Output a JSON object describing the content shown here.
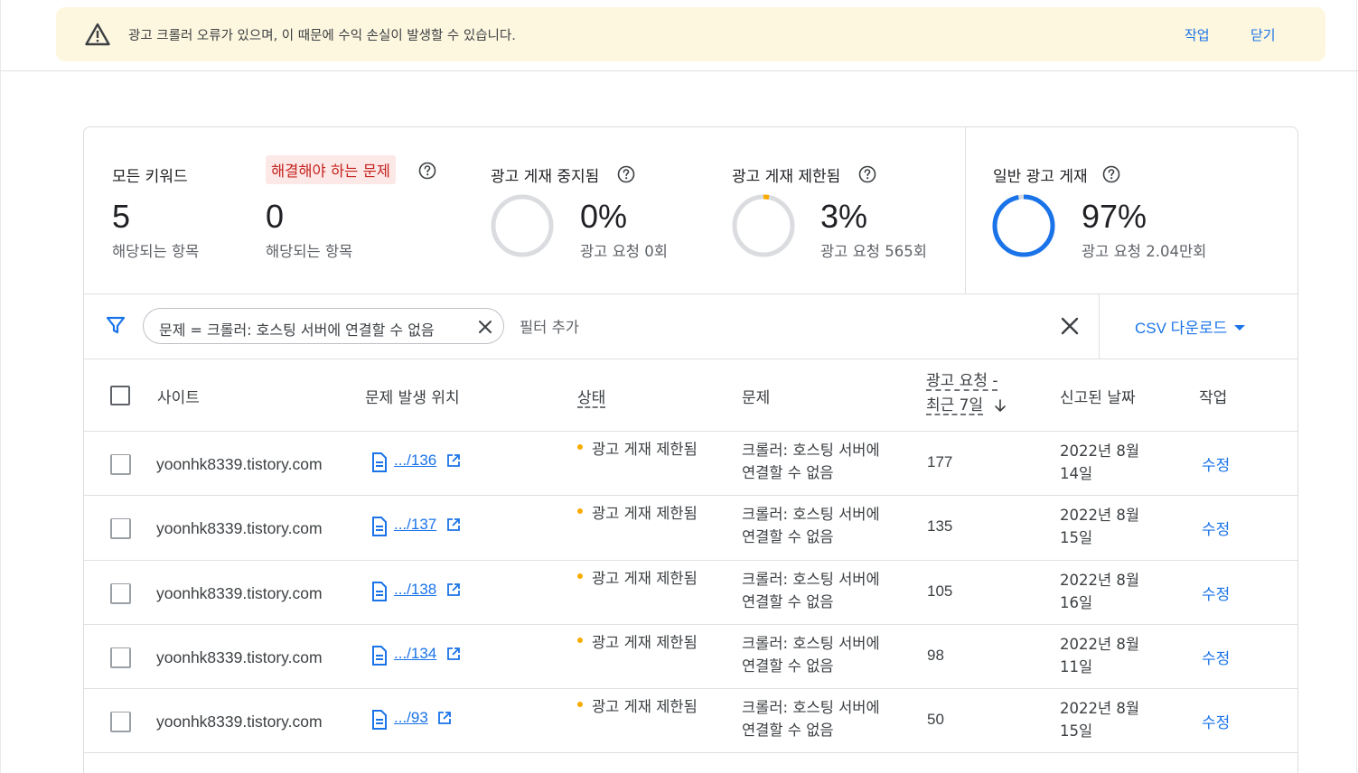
{
  "banner": {
    "message": "광고 크롤러 오류가 있으며, 이 때문에 수익 손실이 발생할 수 있습니다.",
    "action_label": "작업",
    "close_label": "닫기",
    "icon": "warning-icon"
  },
  "stats": {
    "all_keywords": {
      "label": "모든 키워드",
      "value": "5",
      "sub": "해당되는 항목"
    },
    "issues_to_fix": {
      "label": "해결해야 하는 문제",
      "value": "0",
      "sub": "해당되는 항목"
    },
    "ad_serving_stopped": {
      "label": "광고 게재 중지됨",
      "value": "0%",
      "sub": "광고 요청 0회",
      "fraction": 0.0
    },
    "ad_serving_limited": {
      "label": "광고 게재 제한됨",
      "value": "3%",
      "sub": "광고 요청 565회",
      "fraction": 0.03
    },
    "normal_ad_serving": {
      "label": "일반 광고 게재",
      "value": "97%",
      "sub": "광고 요청 2.04만회",
      "fraction": 0.97
    }
  },
  "colors": {
    "accent": "#1a73e8",
    "limited": "#f9ab00",
    "donut_track": "#dadce0",
    "danger_bg": "#fce8e6",
    "banner_bg": "#fef7e0"
  },
  "filter": {
    "chip_label": "문제 = 크롤러: 호스팅 서버에 연결할 수 없음",
    "add_filter_placeholder": "필터 추가",
    "csv_download_label": "CSV 다운로드"
  },
  "table": {
    "headers": {
      "site": "사이트",
      "location": "문제 발생 위치",
      "status": "상태",
      "issue": "문제",
      "requests_line1": "광고 요청 -",
      "requests_line2": "최근 7일",
      "reported_date": "신고된 날짜",
      "action": "작업"
    },
    "rows": [
      {
        "site": "yoonhk8339.tistory.com",
        "location": ".../136",
        "status": "광고 게재 제한됨",
        "issue": "크롤러: 호스팅 서버에 연결할 수 없음",
        "requests": "177",
        "date": "2022년 8월 14일",
        "action": "수정"
      },
      {
        "site": "yoonhk8339.tistory.com",
        "location": ".../137",
        "status": "광고 게재 제한됨",
        "issue": "크롤러: 호스팅 서버에 연결할 수 없음",
        "requests": "135",
        "date": "2022년 8월 15일",
        "action": "수정"
      },
      {
        "site": "yoonhk8339.tistory.com",
        "location": ".../138",
        "status": "광고 게재 제한됨",
        "issue": "크롤러: 호스팅 서버에 연결할 수 없음",
        "requests": "105",
        "date": "2022년 8월 16일",
        "action": "수정"
      },
      {
        "site": "yoonhk8339.tistory.com",
        "location": ".../134",
        "status": "광고 게재 제한됨",
        "issue": "크롤러: 호스팅 서버에 연결할 수 없음",
        "requests": "98",
        "date": "2022년 8월 11일",
        "action": "수정"
      },
      {
        "site": "yoonhk8339.tistory.com",
        "location": ".../93",
        "status": "광고 게재 제한됨",
        "issue": "크롤러: 호스팅 서버에 연결할 수 없음",
        "requests": "50",
        "date": "2022년 8월 15일",
        "action": "수정"
      }
    ]
  }
}
